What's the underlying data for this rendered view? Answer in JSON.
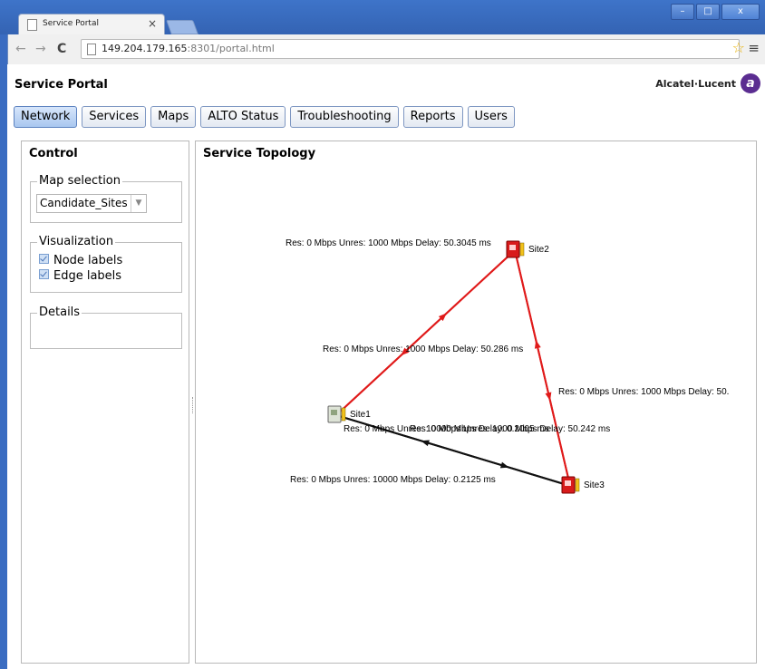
{
  "browser": {
    "tab_title": "Service Portal",
    "tab_close": "×",
    "url_host": "149.204.179.165",
    "url_rest": ":8301/portal.html"
  },
  "page": {
    "title": "Service Portal",
    "brand": "Alcatel·Lucent",
    "tabs": [
      "Network",
      "Services",
      "Maps",
      "ALTO Status",
      "Troubleshooting",
      "Reports",
      "Users"
    ],
    "active_tab": "Network"
  },
  "control": {
    "title": "Control",
    "map_selection_legend": "Map selection",
    "map_selection_value": "Candidate_Sites",
    "visualization_legend": "Visualization",
    "node_labels": "Node labels",
    "node_labels_checked": true,
    "edge_labels": "Edge labels",
    "edge_labels_checked": true,
    "details_legend": "Details"
  },
  "topology": {
    "title": "Service Topology",
    "nodes": [
      {
        "id": "site1",
        "label": "Site1",
        "style": "gray"
      },
      {
        "id": "site2",
        "label": "Site2",
        "style": "red"
      },
      {
        "id": "site3",
        "label": "Site3",
        "style": "red"
      }
    ],
    "edges": [
      {
        "id": "site1-site2",
        "color": "#e01a1a",
        "label": "Res: 0 Mbps Unres: 1000 Mbps Delay: 50.286 ms"
      },
      {
        "id": "site2-site1",
        "color": "#e01a1a",
        "label": "Res: 0 Mbps Unres: 1000 Mbps Delay: 50.3045 ms"
      },
      {
        "id": "site2-site3",
        "color": "#e01a1a",
        "label": "Res: 0 Mbps Unres: 1000 Mbps Delay: 50."
      },
      {
        "id": "site3-site2",
        "color": "#e01a1a",
        "label": "Res: 0 Mbps Unres: 1000 Mbps Delay: 50.242 ms"
      },
      {
        "id": "site1-site3",
        "color": "#111111",
        "label": "Res: 0 Mbps Unres: 10000 Mbps Delay: 0.2125 ms"
      },
      {
        "id": "site3-site1",
        "color": "#111111",
        "label": "Res: 0 Mbps Unres: 10000 Mbps Delay: 0.2005 ms"
      }
    ]
  }
}
